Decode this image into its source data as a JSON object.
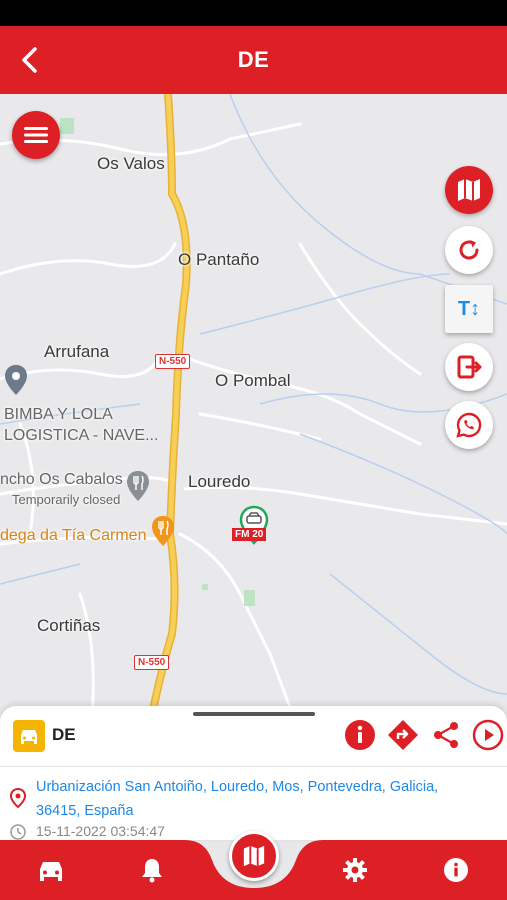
{
  "header": {
    "title": "DE",
    "back_icon": "chevron-left-icon"
  },
  "map": {
    "places": {
      "os_valos": "Os Valos",
      "o_pantano": "O Pantaño",
      "arrufana": "Arrufana",
      "o_pombal": "O Pombal",
      "bimba_line1": "BIMBA Y LOLA",
      "bimba_line2": "LOGISTICA - NAVE...",
      "rancho": "ncho Os Cabalos",
      "rancho_status": "Temporarily closed",
      "louredo": "Louredo",
      "bodega": "dega da Tía Carmen",
      "cortinas": "Cortiñas"
    },
    "road_shields": {
      "top": "N-550",
      "bottom": "N-550"
    },
    "vehicle_plate": "FM 20"
  },
  "side_actions": {
    "textsize_label": "T↕",
    "icons": [
      "map-icon",
      "refresh-icon",
      "text-size-icon",
      "exit-icon",
      "whatsapp-icon"
    ]
  },
  "panel": {
    "vehicle_name": "DE",
    "address": "Urbanización San Antoiño, Louredo, Mos, Pontevedra, Galicia, 36415, España",
    "timestamp": "15-11-2022 03:54:47"
  },
  "bottom_nav": {
    "items": [
      "car-icon",
      "bell-icon",
      "map-icon",
      "gear-icon",
      "info-icon"
    ]
  },
  "colors": {
    "brand_red": "#dd1f26",
    "link_blue": "#1e88e5",
    "vehicle_yellow": "#f5b400"
  }
}
